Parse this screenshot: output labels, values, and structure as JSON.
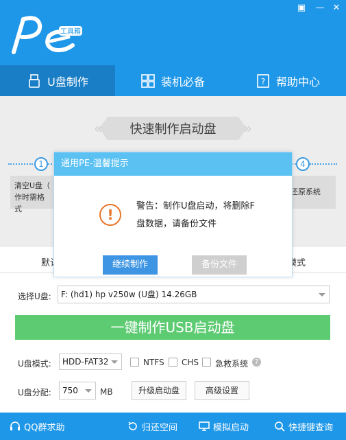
{
  "window": {
    "menu_glyph": "▣",
    "min_glyph": "—",
    "close_glyph": "✕"
  },
  "logo": {
    "text": "Pe",
    "sub": "工具箱"
  },
  "nav": {
    "tabs": [
      {
        "label": "U盘制作",
        "icon": "usb-icon",
        "active": true
      },
      {
        "label": "装机必备",
        "icon": "grid-icon",
        "active": false
      },
      {
        "label": "帮助中心",
        "icon": "help-book-icon",
        "active": false
      }
    ]
  },
  "banner": {
    "title": "快速制作启动盘"
  },
  "steps": {
    "step1": "1",
    "step4": "4",
    "card1_line1": "清空U盘（",
    "card1_line2": "作时需格式",
    "card4_text": "还原系统"
  },
  "tabs2": {
    "left": "默认",
    "right": "模式"
  },
  "form": {
    "select_usb_label": "选择U盘:",
    "select_usb_value": "F: (hd1) hp v250w  (U盘) 14.26GB",
    "make_button": "一键制作USB启动盘",
    "mode_label": "U盘模式:",
    "mode_value": "HDD-FAT32",
    "ntfs": "NTFS",
    "chs": "CHS",
    "rescue": "急救系统",
    "help_glyph": "?",
    "partition_label": "U盘分配:",
    "partition_value": "750",
    "partition_unit": "MB",
    "upgrade_button": "升级启动盘",
    "advanced_button": "高级设置"
  },
  "footer": {
    "qq": "QQ群求助",
    "restore": "归还空间",
    "simulate": "模拟启动",
    "shortcut": "快捷键查询"
  },
  "dialog": {
    "title": "通用PE-温馨提示",
    "icon_glyph": "!",
    "message_line1": "警告：制作U盘启动，将删除F",
    "message_line2": "盘数据，请备份文件",
    "continue_button": "继续制作",
    "backup_button": "备份文件"
  },
  "colors": {
    "primary": "#1f97e8",
    "nav_active": "#1a7ec6",
    "dialog_title": "#5bc1f2",
    "make_button": "#5dcb72",
    "warning": "#e8762a",
    "continue_button": "#3d95e3",
    "backup_button": "#cfcfcf"
  }
}
